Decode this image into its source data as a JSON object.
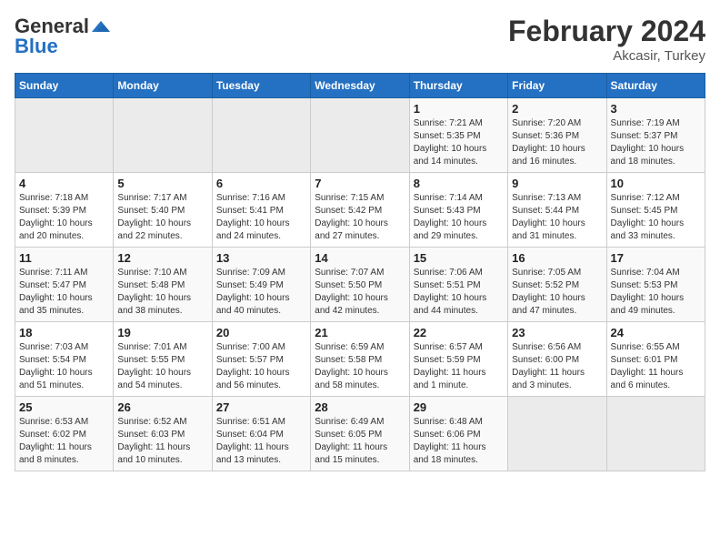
{
  "logo": {
    "general": "General",
    "blue": "Blue"
  },
  "header": {
    "title": "February 2024",
    "subtitle": "Akcasir, Turkey"
  },
  "columns": [
    "Sunday",
    "Monday",
    "Tuesday",
    "Wednesday",
    "Thursday",
    "Friday",
    "Saturday"
  ],
  "weeks": [
    {
      "days": [
        {
          "num": "",
          "info": "",
          "empty": true
        },
        {
          "num": "",
          "info": "",
          "empty": true
        },
        {
          "num": "",
          "info": "",
          "empty": true
        },
        {
          "num": "",
          "info": "",
          "empty": true
        },
        {
          "num": "1",
          "info": "Sunrise: 7:21 AM\nSunset: 5:35 PM\nDaylight: 10 hours\nand 14 minutes."
        },
        {
          "num": "2",
          "info": "Sunrise: 7:20 AM\nSunset: 5:36 PM\nDaylight: 10 hours\nand 16 minutes."
        },
        {
          "num": "3",
          "info": "Sunrise: 7:19 AM\nSunset: 5:37 PM\nDaylight: 10 hours\nand 18 minutes."
        }
      ]
    },
    {
      "days": [
        {
          "num": "4",
          "info": "Sunrise: 7:18 AM\nSunset: 5:39 PM\nDaylight: 10 hours\nand 20 minutes."
        },
        {
          "num": "5",
          "info": "Sunrise: 7:17 AM\nSunset: 5:40 PM\nDaylight: 10 hours\nand 22 minutes."
        },
        {
          "num": "6",
          "info": "Sunrise: 7:16 AM\nSunset: 5:41 PM\nDaylight: 10 hours\nand 24 minutes."
        },
        {
          "num": "7",
          "info": "Sunrise: 7:15 AM\nSunset: 5:42 PM\nDaylight: 10 hours\nand 27 minutes."
        },
        {
          "num": "8",
          "info": "Sunrise: 7:14 AM\nSunset: 5:43 PM\nDaylight: 10 hours\nand 29 minutes."
        },
        {
          "num": "9",
          "info": "Sunrise: 7:13 AM\nSunset: 5:44 PM\nDaylight: 10 hours\nand 31 minutes."
        },
        {
          "num": "10",
          "info": "Sunrise: 7:12 AM\nSunset: 5:45 PM\nDaylight: 10 hours\nand 33 minutes."
        }
      ]
    },
    {
      "days": [
        {
          "num": "11",
          "info": "Sunrise: 7:11 AM\nSunset: 5:47 PM\nDaylight: 10 hours\nand 35 minutes."
        },
        {
          "num": "12",
          "info": "Sunrise: 7:10 AM\nSunset: 5:48 PM\nDaylight: 10 hours\nand 38 minutes."
        },
        {
          "num": "13",
          "info": "Sunrise: 7:09 AM\nSunset: 5:49 PM\nDaylight: 10 hours\nand 40 minutes."
        },
        {
          "num": "14",
          "info": "Sunrise: 7:07 AM\nSunset: 5:50 PM\nDaylight: 10 hours\nand 42 minutes."
        },
        {
          "num": "15",
          "info": "Sunrise: 7:06 AM\nSunset: 5:51 PM\nDaylight: 10 hours\nand 44 minutes."
        },
        {
          "num": "16",
          "info": "Sunrise: 7:05 AM\nSunset: 5:52 PM\nDaylight: 10 hours\nand 47 minutes."
        },
        {
          "num": "17",
          "info": "Sunrise: 7:04 AM\nSunset: 5:53 PM\nDaylight: 10 hours\nand 49 minutes."
        }
      ]
    },
    {
      "days": [
        {
          "num": "18",
          "info": "Sunrise: 7:03 AM\nSunset: 5:54 PM\nDaylight: 10 hours\nand 51 minutes."
        },
        {
          "num": "19",
          "info": "Sunrise: 7:01 AM\nSunset: 5:55 PM\nDaylight: 10 hours\nand 54 minutes."
        },
        {
          "num": "20",
          "info": "Sunrise: 7:00 AM\nSunset: 5:57 PM\nDaylight: 10 hours\nand 56 minutes."
        },
        {
          "num": "21",
          "info": "Sunrise: 6:59 AM\nSunset: 5:58 PM\nDaylight: 10 hours\nand 58 minutes."
        },
        {
          "num": "22",
          "info": "Sunrise: 6:57 AM\nSunset: 5:59 PM\nDaylight: 11 hours\nand 1 minute."
        },
        {
          "num": "23",
          "info": "Sunrise: 6:56 AM\nSunset: 6:00 PM\nDaylight: 11 hours\nand 3 minutes."
        },
        {
          "num": "24",
          "info": "Sunrise: 6:55 AM\nSunset: 6:01 PM\nDaylight: 11 hours\nand 6 minutes."
        }
      ]
    },
    {
      "days": [
        {
          "num": "25",
          "info": "Sunrise: 6:53 AM\nSunset: 6:02 PM\nDaylight: 11 hours\nand 8 minutes."
        },
        {
          "num": "26",
          "info": "Sunrise: 6:52 AM\nSunset: 6:03 PM\nDaylight: 11 hours\nand 10 minutes."
        },
        {
          "num": "27",
          "info": "Sunrise: 6:51 AM\nSunset: 6:04 PM\nDaylight: 11 hours\nand 13 minutes."
        },
        {
          "num": "28",
          "info": "Sunrise: 6:49 AM\nSunset: 6:05 PM\nDaylight: 11 hours\nand 15 minutes."
        },
        {
          "num": "29",
          "info": "Sunrise: 6:48 AM\nSunset: 6:06 PM\nDaylight: 11 hours\nand 18 minutes."
        },
        {
          "num": "",
          "info": "",
          "empty": true
        },
        {
          "num": "",
          "info": "",
          "empty": true
        }
      ]
    }
  ]
}
